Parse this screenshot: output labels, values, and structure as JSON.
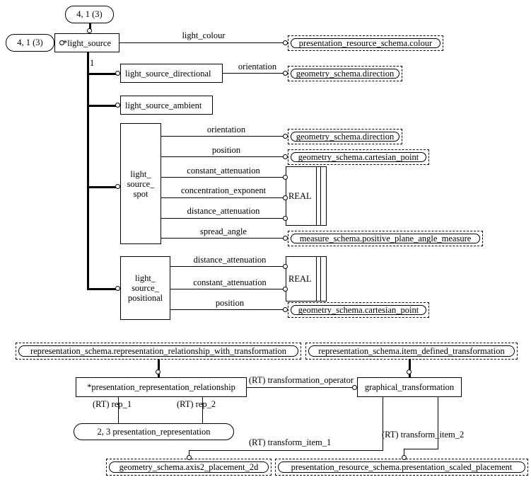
{
  "diagram": {
    "title": "EXPRESS-G entity level diagram",
    "notation": "EXPRESS-G"
  },
  "page_refs": [
    {
      "id": "pr-top",
      "label": "4, 1 (3)"
    },
    {
      "id": "pr-left",
      "label": "4, 1 (3)"
    }
  ],
  "entities": {
    "light_source": "*light_source",
    "light_source_directional": "light_source_directional",
    "light_source_ambient": "light_source_ambient",
    "light_source_spot_l1": "light_",
    "light_source_spot_l2": "source_",
    "light_source_spot_l3": "spot",
    "light_source_positional_l1": "light_",
    "light_source_positional_l2": "source_",
    "light_source_positional_l3": "positional",
    "presentation_representation_relationship": "*presentation_representation_relationship",
    "graphical_transformation": "graphical_transformation",
    "presentation_representation": "2, 3 presentation_representation"
  },
  "types": {
    "real_spot": "REAL",
    "real_positional": "REAL"
  },
  "refs": {
    "colour": "presentation_resource_schema.colour",
    "direction_directional": "geometry_schema.direction",
    "direction_spot": "geometry_schema.direction",
    "cartesian_point_spot": "geometry_schema.cartesian_point",
    "positive_plane_angle_measure": "measure_schema.positive_plane_angle_measure",
    "cartesian_point_positional": "geometry_schema.cartesian_point",
    "rep_rel_with_transformation": "representation_schema.representation_relationship_with_transformation",
    "item_defined_transformation": "representation_schema.item_defined_transformation",
    "axis2_placement_2d": "geometry_schema.axis2_placement_2d",
    "scaled_placement": "presentation_resource_schema.presentation_scaled_placement"
  },
  "attributes": {
    "light_colour": "light_colour",
    "subtype_constraint": "1",
    "orientation_directional": "orientation",
    "orientation_spot": "orientation",
    "position_spot": "position",
    "constant_attenuation_spot": "constant_attenuation",
    "concentration_exponent": "concentration_exponent",
    "distance_attenuation_spot": "distance_attenuation",
    "spread_angle": "spread_angle",
    "distance_attenuation_positional": "distance_attenuation",
    "constant_attenuation_positional": "constant_attenuation",
    "position_positional": "position",
    "transformation_operator": "(RT) transformation_operator",
    "rep_1": "(RT) rep_1",
    "rep_2": "(RT) rep_2",
    "transform_item_1": "(RT) transform_item_1",
    "transform_item_2": "(RT) transform_item_2"
  },
  "colors": {
    "stroke": "#000000",
    "background": "#ffffff"
  }
}
